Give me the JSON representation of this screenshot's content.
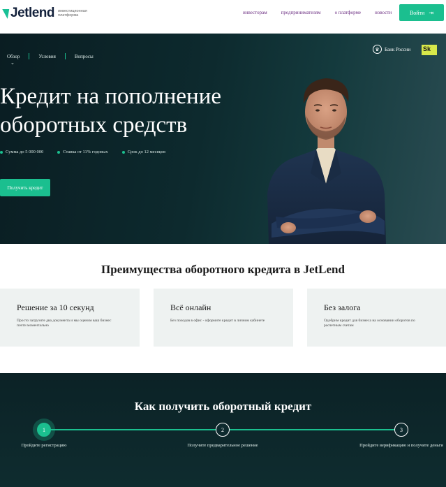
{
  "header": {
    "logo_text": "Jetlend",
    "logo_sub": "инвестиционная платформа",
    "nav": [
      "инвесторам",
      "предпринимателям",
      "о платформе",
      "новости"
    ],
    "login_label": "Войти"
  },
  "hero": {
    "tabs": [
      "Обзор",
      "Условия",
      "Вопросы"
    ],
    "title": "Кредит на пополнение оборотных средств",
    "features": [
      "Сумма до 5 000 000",
      "Ставка от 11% годовых",
      "Срок до 12 месяцев"
    ],
    "cta_label": "Получить кредит",
    "bank_label": "Банк России",
    "sk_label": "Sk"
  },
  "advantages": {
    "title": "Преимущества оборотного кредита в JetLend",
    "cards": [
      {
        "title": "Решение за 10 секунд",
        "text": "Просто загрузите два документа и мы оценим ваш бизнес почти моментально"
      },
      {
        "title": "Всё онлайн",
        "text": "Без походов в офис - оформите кредит в личном кабинете"
      },
      {
        "title": "Без залога",
        "text": "Одобрим кредит для бизнеса на основании оборотов по расчетным счетам"
      }
    ]
  },
  "steps": {
    "title": "Как получить оборотный кредит",
    "items": [
      {
        "num": "1",
        "label": "Пройдите регистрацию"
      },
      {
        "num": "2",
        "label": "Получите предварительное решение"
      },
      {
        "num": "3",
        "label": "Пройдите верификацию и получите деньги"
      }
    ]
  },
  "colors": {
    "accent": "#1bbf8f",
    "dark": "#0d2a2e",
    "nav": "#6a2c80"
  }
}
